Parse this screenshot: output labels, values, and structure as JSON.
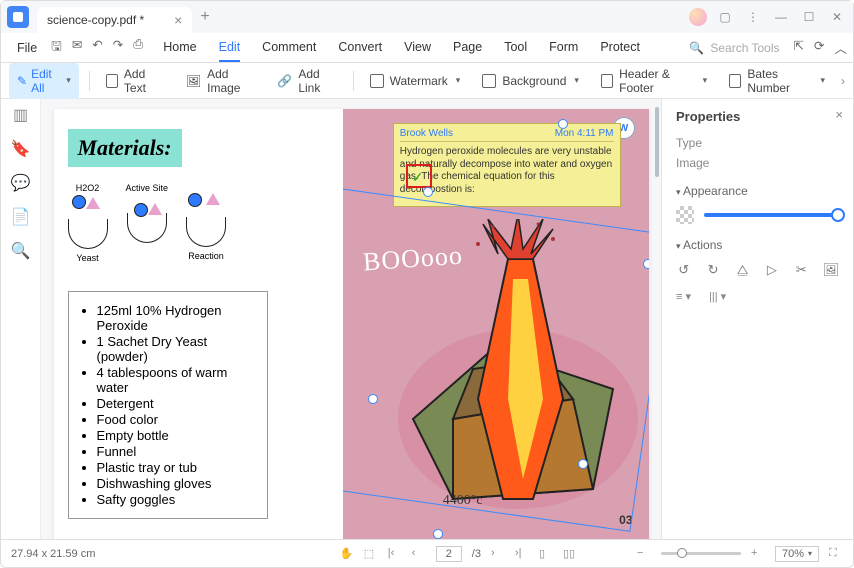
{
  "titlebar": {
    "filename": "science-copy.pdf *"
  },
  "menubar": {
    "file": "File",
    "tabs": [
      "Home",
      "Edit",
      "Comment",
      "Convert",
      "View",
      "Page",
      "Tool",
      "Form",
      "Protect"
    ],
    "active_tab": 1,
    "search_placeholder": "Search Tools"
  },
  "toolbar": {
    "edit_all": "Edit All",
    "add_text": "Add Text",
    "add_image": "Add Image",
    "add_link": "Add Link",
    "watermark": "Watermark",
    "background": "Background",
    "header_footer": "Header & Footer",
    "bates_number": "Bates Number"
  },
  "document": {
    "materials_heading": "Materials:",
    "diagram_labels": {
      "h2o2": "H2O2",
      "active_site": "Active Site",
      "yeast": "Yeast",
      "reaction": "Reaction"
    },
    "materials_list": [
      "125ml 10% Hydrogen Peroxide",
      "1 Sachet Dry Yeast (powder)",
      "4 tablespoons of warm water",
      "Detergent",
      "Food color",
      "Empty bottle",
      "Funnel",
      "Plastic tray or tub",
      "Dishwashing gloves",
      "Safty goggles"
    ],
    "note": {
      "author": "Brook Wells",
      "time": "Mon 4:11 PM",
      "body": "Hydrogen peroxide molecules are very unstable and naturally decompose into water and oxygen gas. The chemical equation for this decompostion is:"
    },
    "boo": "BOOooo",
    "temp": "4400°c",
    "page_number": "03"
  },
  "properties": {
    "title": "Properties",
    "type_label": "Type",
    "type_value": "Image",
    "appearance_label": "Appearance",
    "actions_label": "Actions"
  },
  "statusbar": {
    "dimensions": "27.94 x 21.59 cm",
    "current_page": "2",
    "total_pages": "/3",
    "zoom": "70%"
  }
}
